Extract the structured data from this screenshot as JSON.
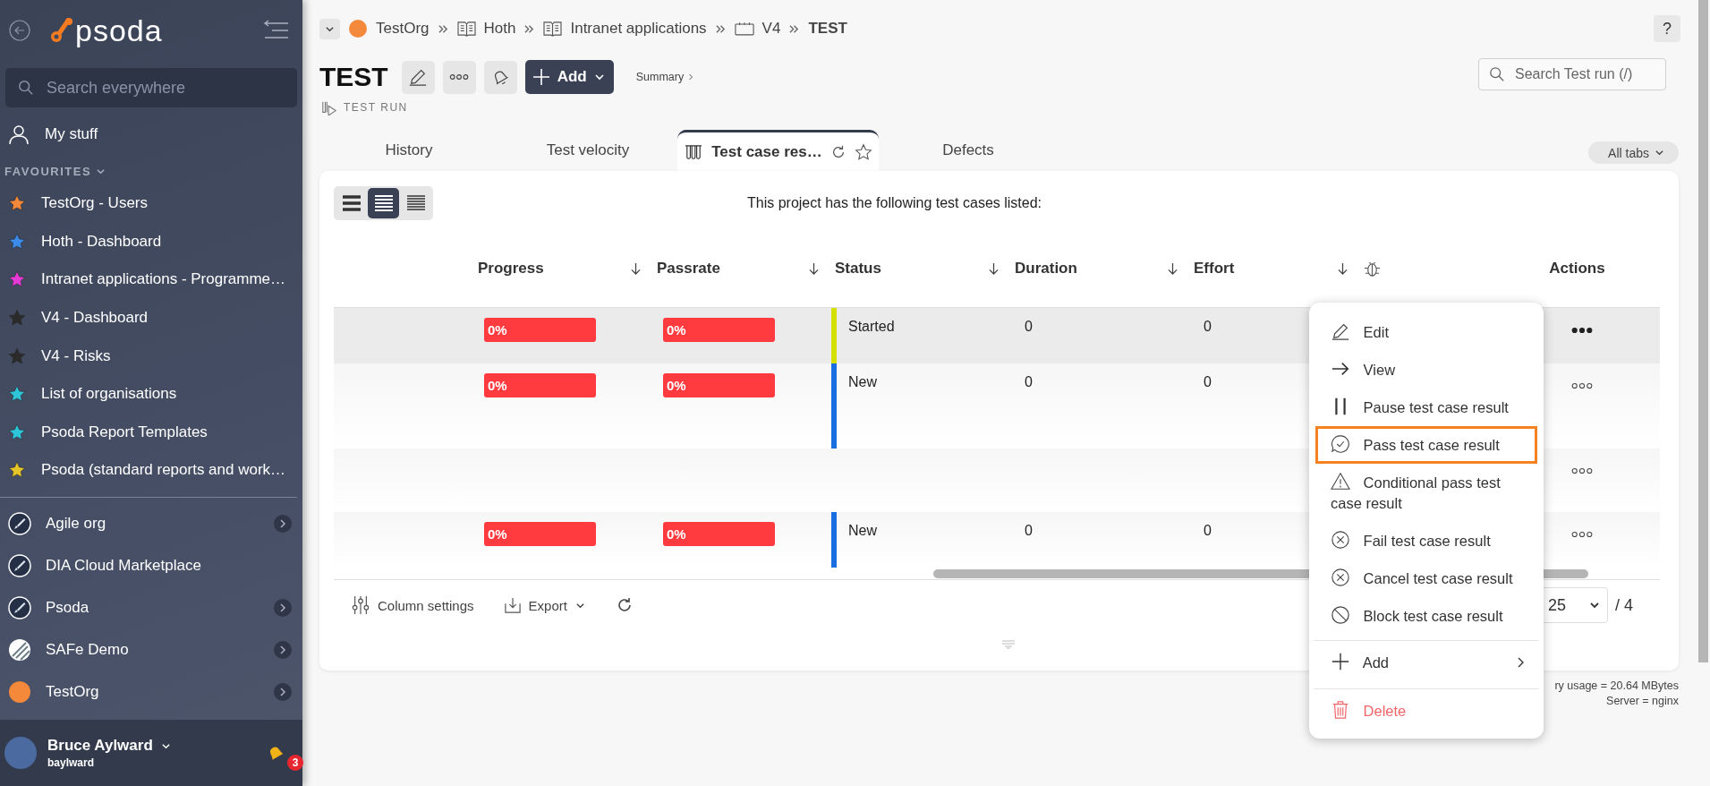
{
  "sidebar": {
    "logo": "psoda",
    "search": {
      "placeholder": "Search everywhere"
    },
    "my_stuff": "My stuff",
    "favourites": {
      "title": "FAVOURITES",
      "expanded": true,
      "items": [
        {
          "label": "TestOrg - Users",
          "color": "#f5893b"
        },
        {
          "label": "Hoth - Dashboard",
          "color": "#3b8beb"
        },
        {
          "label": "Intranet applications - Programme…",
          "color": "#e33ad6"
        },
        {
          "label": "V4 - Dashboard",
          "color": "#2b2b2b"
        },
        {
          "label": "V4 - Risks",
          "color": "#2b2b2b"
        },
        {
          "label": "List of organisations",
          "color": "#2ec5d9"
        },
        {
          "label": "Psoda Report Templates",
          "color": "#2ec5d9"
        },
        {
          "label": "Psoda (standard reports and work…",
          "color": "#e6c52b"
        }
      ]
    },
    "organisations": [
      {
        "label": "Agile org",
        "kind": "rocket",
        "has_children": true
      },
      {
        "label": "DIA Cloud Marketplace",
        "kind": "rocket",
        "has_children": false
      },
      {
        "label": "Psoda",
        "kind": "rocket",
        "has_children": true
      },
      {
        "label": "SAFe Demo",
        "kind": "stripes",
        "has_children": true
      },
      {
        "label": "TestOrg",
        "kind": "sun",
        "has_children": true
      }
    ],
    "user": {
      "name": "Bruce Aylward",
      "username": "baylward",
      "notifications": "3"
    }
  },
  "breadcrumbs": [
    {
      "label": "TestOrg",
      "kind": "org"
    },
    {
      "label": "Hoth",
      "kind": "book"
    },
    {
      "label": "Intranet applications",
      "kind": "book"
    },
    {
      "label": "V4",
      "kind": "board"
    },
    {
      "label": "TEST",
      "kind": "current"
    }
  ],
  "header": {
    "title": "TEST",
    "type": "TEST RUN",
    "add": "Add",
    "summary": "Summary",
    "search_placeholder": "Search Test run (/)",
    "help": "?"
  },
  "tabs": [
    {
      "label": "History",
      "selected": false
    },
    {
      "label": "Test velocity",
      "selected": false
    },
    {
      "label": "Test case res…",
      "selected": true
    },
    {
      "label": "Defects",
      "selected": false
    }
  ],
  "all_tabs": "All tabs",
  "view_modes": [
    {
      "kind": "large",
      "selected": false
    },
    {
      "kind": "medium",
      "selected": true
    },
    {
      "kind": "small",
      "selected": false
    }
  ],
  "intro": "This project has the following test cases listed:",
  "columns": [
    {
      "kind": "text",
      "label": "Progress",
      "sortable": true
    },
    {
      "kind": "text",
      "label": "Passrate",
      "sortable": true
    },
    {
      "kind": "text",
      "label": "Status",
      "sortable": true
    },
    {
      "kind": "text",
      "label": "Duration",
      "sortable": true
    },
    {
      "kind": "text",
      "label": "Effort",
      "sortable": true
    },
    {
      "kind": "bug",
      "sortable": false
    },
    {
      "kind": "text",
      "label": "Actions",
      "sortable": false
    }
  ],
  "rows": [
    {
      "selected": true,
      "menu_open": true,
      "progress": "0%",
      "passrate": "0%",
      "status": "Started",
      "color": "#d4e000",
      "duration": "0",
      "effort": "0"
    },
    {
      "selected": false,
      "menu_open": false,
      "progress": "0%",
      "passrate": "0%",
      "status": "New",
      "color": "#1a6fe0",
      "duration": "0",
      "effort": "0"
    },
    {
      "selected": false,
      "menu_open": false
    },
    {
      "selected": false,
      "menu_open": false,
      "progress": "0%",
      "passrate": "0%",
      "status": "New",
      "color": "#1a6fe0",
      "duration": "0",
      "effort": "0"
    }
  ],
  "footer": {
    "column_settings": "Column settings",
    "export": "Export",
    "page_size": "25",
    "pages": "/ 4"
  },
  "server_info": [
    "ry usage = 20.64 MBytes",
    "Server = nginx"
  ],
  "menu": [
    {
      "kind": "edit",
      "label": "Edit",
      "highlighted": false,
      "separator": false
    },
    {
      "kind": "view",
      "label": "View",
      "highlighted": false,
      "separator": false
    },
    {
      "kind": "pause",
      "label": "Pause test case result",
      "highlighted": false,
      "separator": false
    },
    {
      "kind": "pass",
      "label": "Pass test case result",
      "highlighted": true,
      "separator": false
    },
    {
      "kind": "conditional",
      "label": "Conditional pass test case result",
      "highlighted": false,
      "separator": false
    },
    {
      "kind": "fail",
      "label": "Fail test case result",
      "highlighted": false,
      "separator": false
    },
    {
      "kind": "cancel",
      "label": "Cancel test case result",
      "highlighted": false,
      "separator": false
    },
    {
      "kind": "block",
      "label": "Block test case result",
      "highlighted": false,
      "separator": false
    },
    {
      "kind": "add",
      "label": "Add",
      "highlighted": false,
      "separator": true
    },
    {
      "kind": "delete",
      "label": "Delete",
      "highlighted": false,
      "separator": true
    }
  ]
}
